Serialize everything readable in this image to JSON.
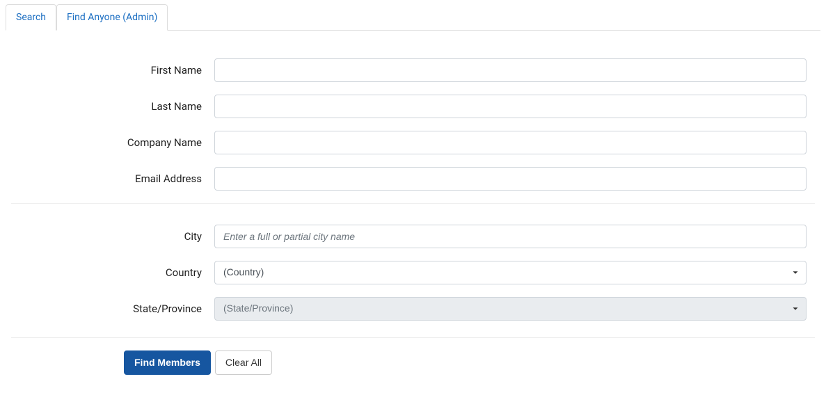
{
  "tabs": {
    "search": "Search",
    "find_anyone": "Find Anyone (Admin)"
  },
  "form": {
    "first_name": {
      "label": "First Name",
      "value": ""
    },
    "last_name": {
      "label": "Last Name",
      "value": ""
    },
    "company_name": {
      "label": "Company Name",
      "value": ""
    },
    "email_address": {
      "label": "Email Address",
      "value": ""
    },
    "city": {
      "label": "City",
      "value": "",
      "placeholder": "Enter a full or partial city name"
    },
    "country": {
      "label": "Country",
      "selected": "(Country)"
    },
    "state_province": {
      "label": "State/Province",
      "selected": "(State/Province)"
    }
  },
  "buttons": {
    "find_members": "Find Members",
    "clear_all": "Clear All"
  }
}
